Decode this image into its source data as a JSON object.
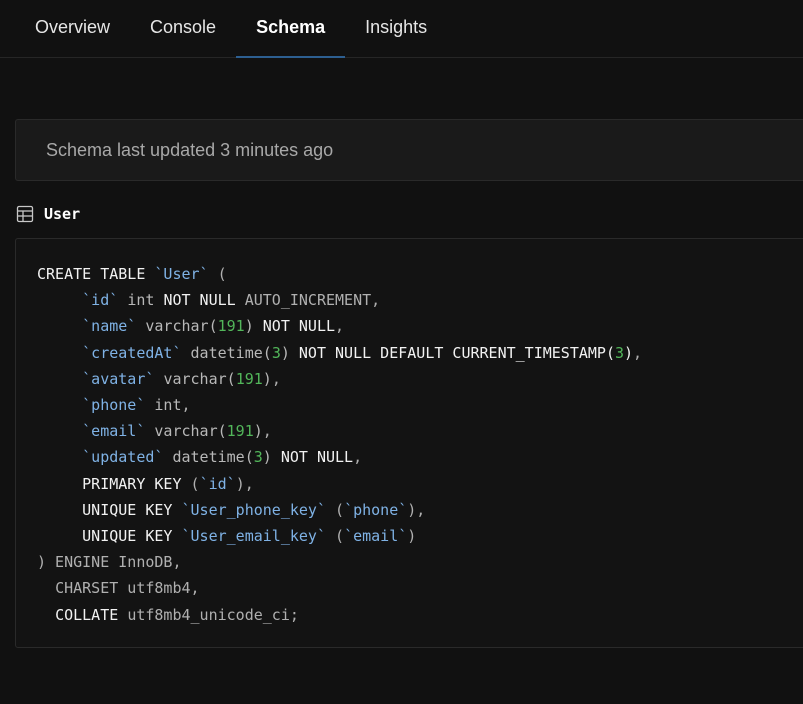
{
  "tabs": [
    {
      "label": "Overview",
      "active": false
    },
    {
      "label": "Console",
      "active": false
    },
    {
      "label": "Schema",
      "active": true
    },
    {
      "label": "Insights",
      "active": false
    }
  ],
  "banner": {
    "text": "Schema last updated 3 minutes ago"
  },
  "table": {
    "icon": "table-icon",
    "name": "User",
    "ddl": {
      "create": "CREATE TABLE",
      "table_name": "`User`",
      "open": "(",
      "columns": [
        {
          "name": "`id`",
          "type": "int",
          "extra": "NOT NULL",
          "extra2": "AUTO_INCREMENT",
          "end": ","
        },
        {
          "name": "`name`",
          "type": "varchar(",
          "arg": "191",
          "type_end": ")",
          "extra": "NOT NULL",
          "end": ","
        },
        {
          "name": "`createdAt`",
          "type": "datetime(",
          "arg": "3",
          "type_end": ")",
          "extra": "NOT NULL DEFAULT CURRENT_TIMESTAMP(",
          "arg2": "3",
          "extra_end": ")",
          "end": ","
        },
        {
          "name": "`avatar`",
          "type": "varchar(",
          "arg": "191",
          "type_end": ")",
          "end": ","
        },
        {
          "name": "`phone`",
          "type": "int",
          "end": ","
        },
        {
          "name": "`email`",
          "type": "varchar(",
          "arg": "191",
          "type_end": ")",
          "end": ","
        },
        {
          "name": "`updated`",
          "type": "datetime(",
          "arg": "3",
          "type_end": ")",
          "extra": "NOT NULL",
          "end": ","
        }
      ],
      "primary_key": {
        "kw": "PRIMARY KEY",
        "open": "(",
        "col": "`id`",
        "close": "),"
      },
      "unique_keys": [
        {
          "kw": "UNIQUE KEY",
          "name": "`User_phone_key`",
          "open": "(",
          "col": "`phone`",
          "close": "),"
        },
        {
          "kw": "UNIQUE KEY",
          "name": "`User_email_key`",
          "open": "(",
          "col": "`email`",
          "close": ")"
        }
      ],
      "engine": ") ENGINE InnoDB,",
      "charset": "CHARSET utf8mb4,",
      "collate_kw": "COLLATE",
      "collate_val": "utf8mb4_unicode_ci;"
    }
  },
  "colors": {
    "background": "#111111",
    "accent": "#2d5f91",
    "identifier": "#7fb2e5",
    "number": "#52b65a"
  }
}
